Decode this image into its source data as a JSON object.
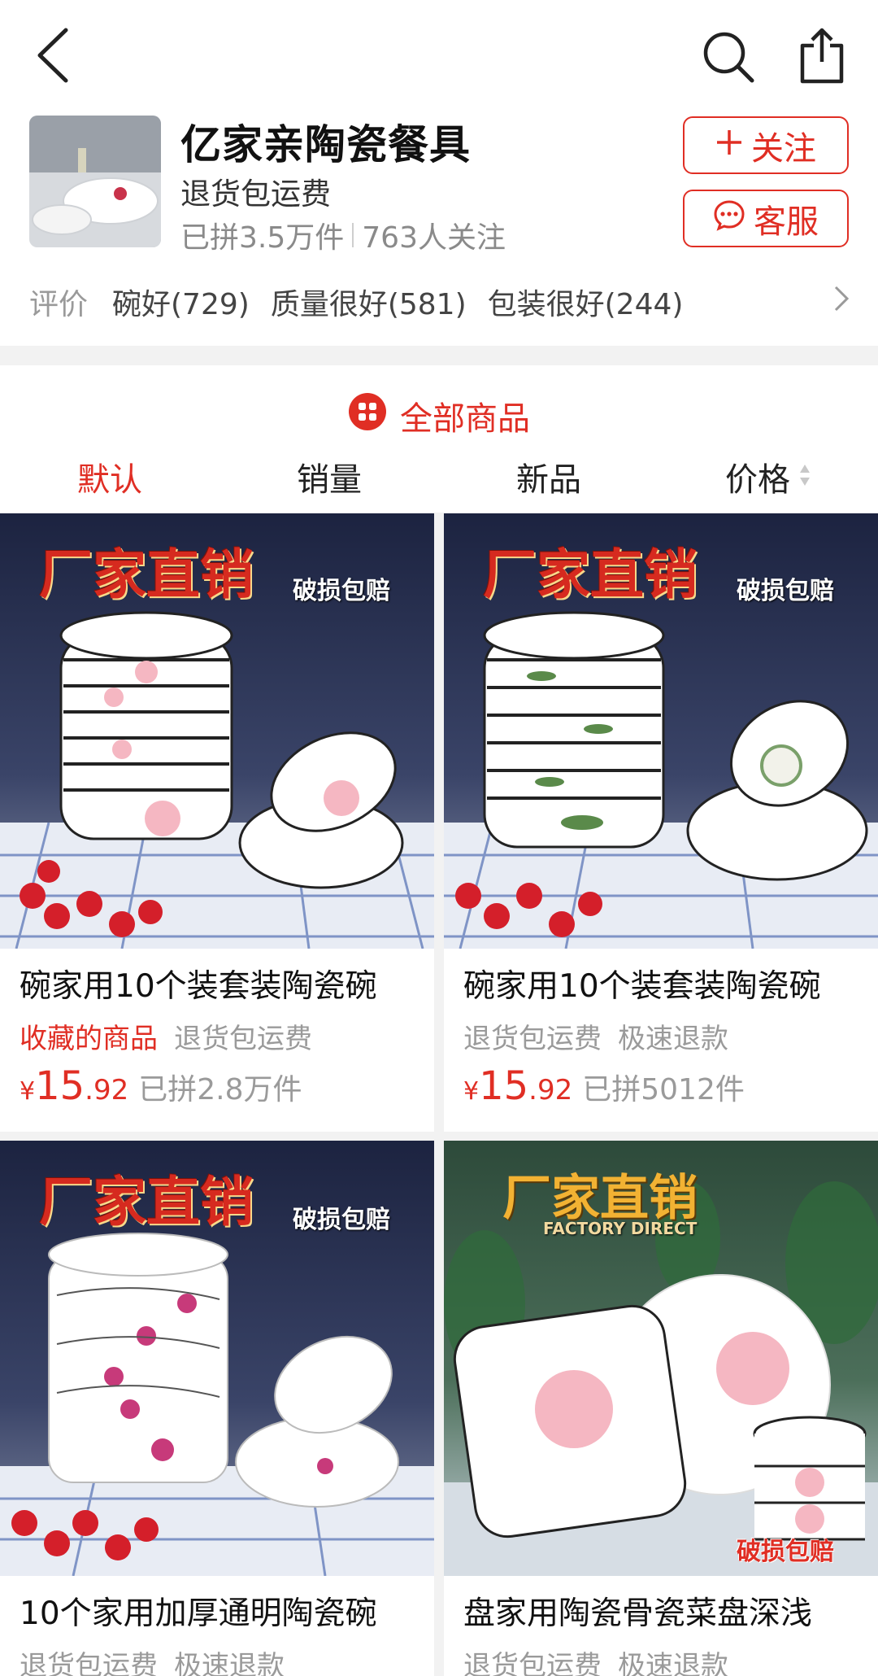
{
  "colors": {
    "accent": "#e02e24",
    "muted": "#9a9a9a",
    "band": "#f2f2f2"
  },
  "topbar": {
    "back_icon": "back-arrow-icon",
    "search_icon": "search-icon",
    "share_icon": "share-icon"
  },
  "shop": {
    "name": "亿家亲陶瓷餐具",
    "subtitle": "退货包运费",
    "sold": "已拼3.5万件",
    "followers": "763人关注",
    "follow_label": "关注",
    "follow_icon": "plus-icon",
    "service_label": "客服",
    "service_icon": "chat-bubble-icon"
  },
  "reviews": {
    "label": "评价",
    "tags": [
      "碗好(729)",
      "质量很好(581)",
      "包装很好(244)"
    ]
  },
  "all_products": {
    "label": "全部商品",
    "icon": "grid-menu-icon"
  },
  "sort": {
    "tabs": [
      "默认",
      "销量",
      "新品",
      "价格"
    ],
    "active": 0
  },
  "products": [
    {
      "title": "碗家用10个装套装陶瓷碗",
      "tags": [
        "收藏的商品",
        "退货包运费"
      ],
      "highlight_first_tag": true,
      "price_symbol": "¥",
      "price_int": "15",
      "price_dec": ".92",
      "sold": "已拼2.8万件",
      "banner": "厂家直销",
      "badge": "破损包赔"
    },
    {
      "title": "碗家用10个装套装陶瓷碗",
      "tags": [
        "退货包运费",
        "极速退款"
      ],
      "highlight_first_tag": false,
      "price_symbol": "¥",
      "price_int": "15",
      "price_dec": ".92",
      "sold": "已拼5012件",
      "banner": "厂家直销",
      "badge": "破损包赔"
    },
    {
      "title": "10个家用加厚通明陶瓷碗",
      "tags": [
        "退货包运费",
        "极速退款"
      ],
      "banner": "厂家直销",
      "badge": "破损包赔"
    },
    {
      "title": "盘家用陶瓷骨瓷菜盘深浅",
      "tags": [
        "退货包运费",
        "极速退款"
      ],
      "banner": "厂家直销",
      "banner_sub": "FACTORY DIRECT",
      "badge": "破损包赔"
    }
  ]
}
